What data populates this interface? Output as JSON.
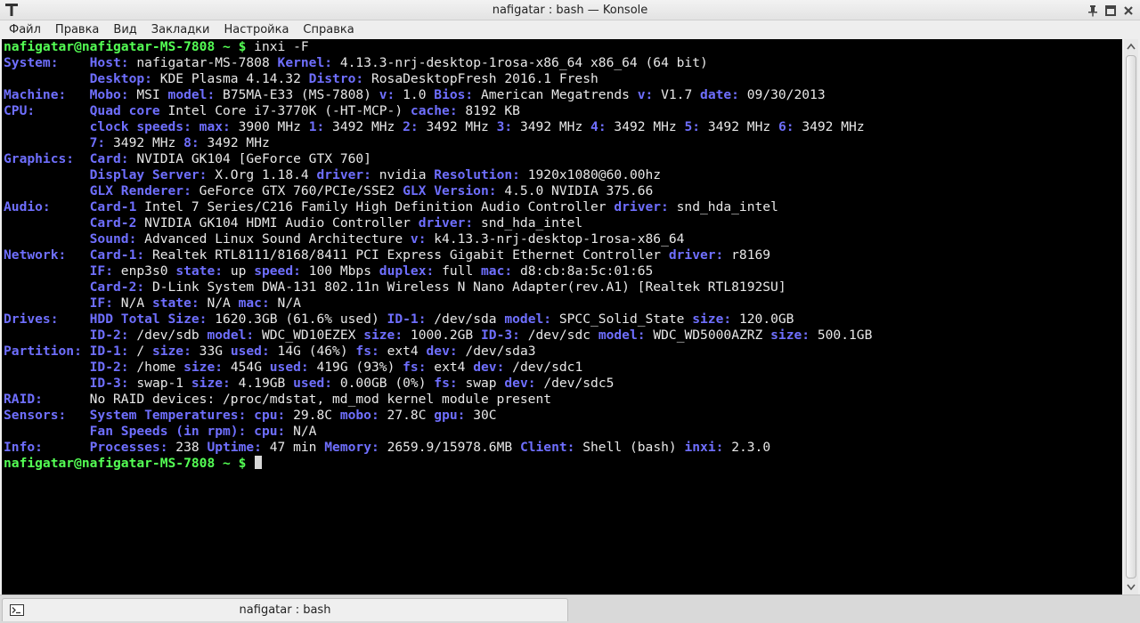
{
  "window": {
    "title": "nafigatar : bash — Konsole",
    "icon": "konsole-t-icon",
    "controls": [
      "pin-icon",
      "maximize-icon",
      "close-icon"
    ]
  },
  "menubar": {
    "items": [
      "Файл",
      "Правка",
      "Вид",
      "Закладки",
      "Настройка",
      "Справка"
    ]
  },
  "terminal": {
    "colors": {
      "background": "#000000",
      "prompt": "#54ff54",
      "key": "#6f6fff",
      "text": "#e8e8e8"
    },
    "lines": [
      [
        {
          "t": "p",
          "v": "nafigatar@nafigatar-MS-7808 ~ $"
        },
        {
          "t": "v",
          "v": " inxi -F"
        }
      ],
      [
        {
          "t": "k",
          "v": "System:    Host:"
        },
        {
          "t": "v",
          "v": " nafigatar-MS-7808 "
        },
        {
          "t": "k",
          "v": "Kernel:"
        },
        {
          "t": "v",
          "v": " 4.13.3-nrj-desktop-1rosa-x86_64 x86_64 (64 bit)"
        }
      ],
      [
        {
          "t": "k",
          "v": "           Desktop:"
        },
        {
          "t": "v",
          "v": " KDE Plasma 4.14.32 "
        },
        {
          "t": "k",
          "v": "Distro:"
        },
        {
          "t": "v",
          "v": " RosaDesktopFresh 2016.1 Fresh"
        }
      ],
      [
        {
          "t": "k",
          "v": "Machine:   Mobo:"
        },
        {
          "t": "v",
          "v": " MSI "
        },
        {
          "t": "k",
          "v": "model:"
        },
        {
          "t": "v",
          "v": " B75MA-E33 (MS-7808) "
        },
        {
          "t": "k",
          "v": "v:"
        },
        {
          "t": "v",
          "v": " 1.0 "
        },
        {
          "t": "k",
          "v": "Bios:"
        },
        {
          "t": "v",
          "v": " American Megatrends "
        },
        {
          "t": "k",
          "v": "v:"
        },
        {
          "t": "v",
          "v": " V1.7 "
        },
        {
          "t": "k",
          "v": "date:"
        },
        {
          "t": "v",
          "v": " 09/30/2013"
        }
      ],
      [
        {
          "t": "k",
          "v": "CPU:       Quad core"
        },
        {
          "t": "v",
          "v": " Intel Core i7-3770K (-HT-MCP-) "
        },
        {
          "t": "k",
          "v": "cache:"
        },
        {
          "t": "v",
          "v": " 8192 KB"
        }
      ],
      [
        {
          "t": "k",
          "v": "           clock speeds:"
        },
        {
          "t": "k",
          "v": " max:"
        },
        {
          "t": "v",
          "v": " 3900 MHz "
        },
        {
          "t": "k",
          "v": "1:"
        },
        {
          "t": "v",
          "v": " 3492 MHz "
        },
        {
          "t": "k",
          "v": "2:"
        },
        {
          "t": "v",
          "v": " 3492 MHz "
        },
        {
          "t": "k",
          "v": "3:"
        },
        {
          "t": "v",
          "v": " 3492 MHz "
        },
        {
          "t": "k",
          "v": "4:"
        },
        {
          "t": "v",
          "v": " 3492 MHz "
        },
        {
          "t": "k",
          "v": "5:"
        },
        {
          "t": "v",
          "v": " 3492 MHz "
        },
        {
          "t": "k",
          "v": "6:"
        },
        {
          "t": "v",
          "v": " 3492 MHz"
        }
      ],
      [
        {
          "t": "k",
          "v": "           7:"
        },
        {
          "t": "v",
          "v": " 3492 MHz "
        },
        {
          "t": "k",
          "v": "8:"
        },
        {
          "t": "v",
          "v": " 3492 MHz"
        }
      ],
      [
        {
          "t": "k",
          "v": "Graphics:  Card:"
        },
        {
          "t": "v",
          "v": " NVIDIA GK104 [GeForce GTX 760]"
        }
      ],
      [
        {
          "t": "k",
          "v": "           Display Server:"
        },
        {
          "t": "v",
          "v": " X.Org 1.18.4 "
        },
        {
          "t": "k",
          "v": "driver:"
        },
        {
          "t": "v",
          "v": " nvidia "
        },
        {
          "t": "k",
          "v": "Resolution:"
        },
        {
          "t": "v",
          "v": " 1920x1080@60.00hz"
        }
      ],
      [
        {
          "t": "k",
          "v": "           GLX Renderer:"
        },
        {
          "t": "v",
          "v": " GeForce GTX 760/PCIe/SSE2 "
        },
        {
          "t": "k",
          "v": "GLX Version:"
        },
        {
          "t": "v",
          "v": " 4.5.0 NVIDIA 375.66"
        }
      ],
      [
        {
          "t": "k",
          "v": "Audio:     Card-1"
        },
        {
          "t": "v",
          "v": " Intel 7 Series/C216 Family High Definition Audio Controller "
        },
        {
          "t": "k",
          "v": "driver:"
        },
        {
          "t": "v",
          "v": " snd_hda_intel"
        }
      ],
      [
        {
          "t": "k",
          "v": "           Card-2"
        },
        {
          "t": "v",
          "v": " NVIDIA GK104 HDMI Audio Controller "
        },
        {
          "t": "k",
          "v": "driver:"
        },
        {
          "t": "v",
          "v": " snd_hda_intel"
        }
      ],
      [
        {
          "t": "k",
          "v": "           Sound:"
        },
        {
          "t": "v",
          "v": " Advanced Linux Sound Architecture "
        },
        {
          "t": "k",
          "v": "v:"
        },
        {
          "t": "v",
          "v": " k4.13.3-nrj-desktop-1rosa-x86_64"
        }
      ],
      [
        {
          "t": "k",
          "v": "Network:   Card-1:"
        },
        {
          "t": "v",
          "v": " Realtek RTL8111/8168/8411 PCI Express Gigabit Ethernet Controller "
        },
        {
          "t": "k",
          "v": "driver:"
        },
        {
          "t": "v",
          "v": " r8169"
        }
      ],
      [
        {
          "t": "k",
          "v": "           IF:"
        },
        {
          "t": "v",
          "v": " enp3s0 "
        },
        {
          "t": "k",
          "v": "state:"
        },
        {
          "t": "v",
          "v": " up "
        },
        {
          "t": "k",
          "v": "speed:"
        },
        {
          "t": "v",
          "v": " 100 Mbps "
        },
        {
          "t": "k",
          "v": "duplex:"
        },
        {
          "t": "v",
          "v": " full "
        },
        {
          "t": "k",
          "v": "mac:"
        },
        {
          "t": "v",
          "v": " d8:cb:8a:5c:01:65"
        }
      ],
      [
        {
          "t": "k",
          "v": "           Card-2:"
        },
        {
          "t": "v",
          "v": " D-Link System DWA-131 802.11n Wireless N Nano Adapter(rev.A1) [Realtek RTL8192SU]"
        }
      ],
      [
        {
          "t": "k",
          "v": "           IF:"
        },
        {
          "t": "v",
          "v": " N/A "
        },
        {
          "t": "k",
          "v": "state:"
        },
        {
          "t": "v",
          "v": " N/A "
        },
        {
          "t": "k",
          "v": "mac:"
        },
        {
          "t": "v",
          "v": " N/A"
        }
      ],
      [
        {
          "t": "k",
          "v": "Drives:    HDD Total Size:"
        },
        {
          "t": "v",
          "v": " 1620.3GB (61.6% used) "
        },
        {
          "t": "k",
          "v": "ID-1:"
        },
        {
          "t": "v",
          "v": " /dev/sda "
        },
        {
          "t": "k",
          "v": "model:"
        },
        {
          "t": "v",
          "v": " SPCC_Solid_State "
        },
        {
          "t": "k",
          "v": "size:"
        },
        {
          "t": "v",
          "v": " 120.0GB"
        }
      ],
      [
        {
          "t": "k",
          "v": "           ID-2:"
        },
        {
          "t": "v",
          "v": " /dev/sdb "
        },
        {
          "t": "k",
          "v": "model:"
        },
        {
          "t": "v",
          "v": " WDC_WD10EZEX "
        },
        {
          "t": "k",
          "v": "size:"
        },
        {
          "t": "v",
          "v": " 1000.2GB "
        },
        {
          "t": "k",
          "v": "ID-3:"
        },
        {
          "t": "v",
          "v": " /dev/sdc "
        },
        {
          "t": "k",
          "v": "model:"
        },
        {
          "t": "v",
          "v": " WDC_WD5000AZRZ "
        },
        {
          "t": "k",
          "v": "size:"
        },
        {
          "t": "v",
          "v": " 500.1GB"
        }
      ],
      [
        {
          "t": "k",
          "v": "Partition: ID-1:"
        },
        {
          "t": "v",
          "v": " / "
        },
        {
          "t": "k",
          "v": "size:"
        },
        {
          "t": "v",
          "v": " 33G "
        },
        {
          "t": "k",
          "v": "used:"
        },
        {
          "t": "v",
          "v": " 14G (46%) "
        },
        {
          "t": "k",
          "v": "fs:"
        },
        {
          "t": "v",
          "v": " ext4 "
        },
        {
          "t": "k",
          "v": "dev:"
        },
        {
          "t": "v",
          "v": " /dev/sda3"
        }
      ],
      [
        {
          "t": "k",
          "v": "           ID-2:"
        },
        {
          "t": "v",
          "v": " /home "
        },
        {
          "t": "k",
          "v": "size:"
        },
        {
          "t": "v",
          "v": " 454G "
        },
        {
          "t": "k",
          "v": "used:"
        },
        {
          "t": "v",
          "v": " 419G (93%) "
        },
        {
          "t": "k",
          "v": "fs:"
        },
        {
          "t": "v",
          "v": " ext4 "
        },
        {
          "t": "k",
          "v": "dev:"
        },
        {
          "t": "v",
          "v": " /dev/sdc1"
        }
      ],
      [
        {
          "t": "k",
          "v": "           ID-3:"
        },
        {
          "t": "v",
          "v": " swap-1 "
        },
        {
          "t": "k",
          "v": "size:"
        },
        {
          "t": "v",
          "v": " 4.19GB "
        },
        {
          "t": "k",
          "v": "used:"
        },
        {
          "t": "v",
          "v": " 0.00GB (0%) "
        },
        {
          "t": "k",
          "v": "fs:"
        },
        {
          "t": "v",
          "v": " swap "
        },
        {
          "t": "k",
          "v": "dev:"
        },
        {
          "t": "v",
          "v": " /dev/sdc5"
        }
      ],
      [
        {
          "t": "k",
          "v": "RAID:"
        },
        {
          "t": "v",
          "v": "      No RAID devices: /proc/mdstat, md_mod kernel module present"
        }
      ],
      [
        {
          "t": "k",
          "v": "Sensors:   System Temperatures:"
        },
        {
          "t": "k",
          "v": " cpu:"
        },
        {
          "t": "v",
          "v": " 29.8C "
        },
        {
          "t": "k",
          "v": "mobo:"
        },
        {
          "t": "v",
          "v": " 27.8C "
        },
        {
          "t": "k",
          "v": "gpu:"
        },
        {
          "t": "v",
          "v": " 30C"
        }
      ],
      [
        {
          "t": "k",
          "v": "           Fan Speeds (in rpm):"
        },
        {
          "t": "k",
          "v": " cpu:"
        },
        {
          "t": "v",
          "v": " N/A"
        }
      ],
      [
        {
          "t": "k",
          "v": "Info:      Processes:"
        },
        {
          "t": "v",
          "v": " 238 "
        },
        {
          "t": "k",
          "v": "Uptime:"
        },
        {
          "t": "v",
          "v": " 47 min "
        },
        {
          "t": "k",
          "v": "Memory:"
        },
        {
          "t": "v",
          "v": " 2659.9/15978.6MB "
        },
        {
          "t": "k",
          "v": "Client:"
        },
        {
          "t": "v",
          "v": " Shell (bash) "
        },
        {
          "t": "k",
          "v": "inxi:"
        },
        {
          "t": "v",
          "v": " 2.3.0"
        }
      ],
      [
        {
          "t": "p",
          "v": "nafigatar@nafigatar-MS-7808 ~ $"
        },
        {
          "t": "v",
          "v": " "
        }
      ]
    ]
  },
  "scrollbar": {
    "icons": [
      "scroll-up-arrow-icon",
      "scroll-down-arrow-icon"
    ]
  },
  "tabs": [
    {
      "label": "nafigatar : bash",
      "icon": "terminal-icon"
    }
  ]
}
